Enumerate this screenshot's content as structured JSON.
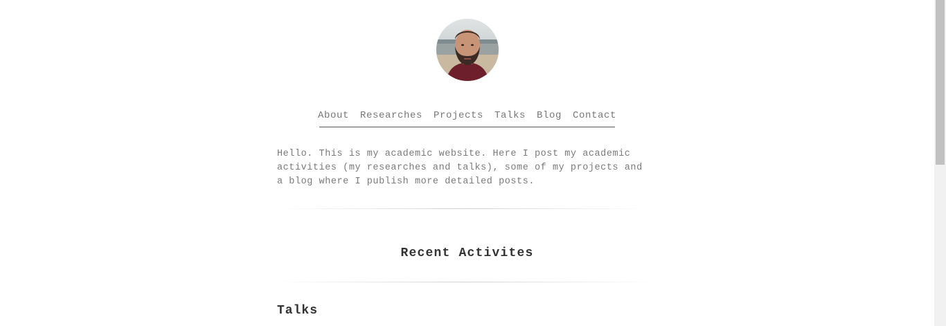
{
  "header": {
    "avatar_alt": "profile photo"
  },
  "nav": {
    "items": [
      {
        "label": "About"
      },
      {
        "label": "Researches"
      },
      {
        "label": "Projects"
      },
      {
        "label": "Talks"
      },
      {
        "label": "Blog"
      },
      {
        "label": "Contact"
      }
    ]
  },
  "main": {
    "intro": "Hello. This is my academic website. Here I post my academic activities (my researches and talks), some of my projects and a blog where I publish more detailed posts.",
    "section_title": "Recent Activites",
    "subsection_title": "Talks"
  }
}
